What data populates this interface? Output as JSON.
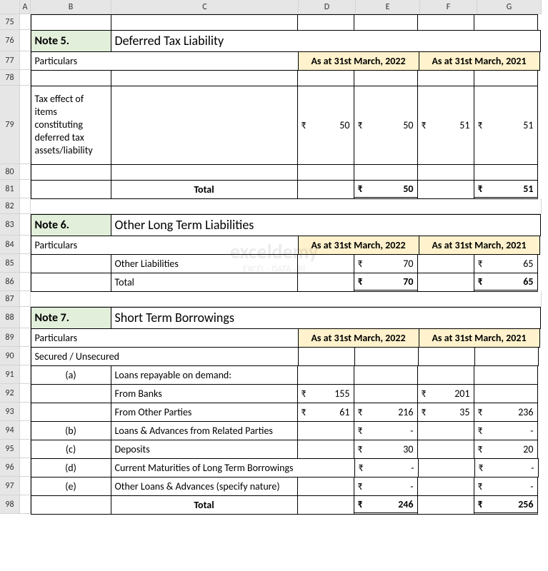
{
  "columns": [
    "A",
    "B",
    "C",
    "D",
    "E",
    "F",
    "G"
  ],
  "column_widths": {
    "A": 15,
    "B": 113,
    "C": 262,
    "D": 80,
    "E": 90,
    "F": 80,
    "G": 90
  },
  "rows": [
    75,
    76,
    77,
    78,
    79,
    80,
    81,
    82,
    83,
    84,
    85,
    86,
    87,
    88,
    89,
    90,
    91,
    92,
    93,
    94,
    95,
    96,
    97,
    98
  ],
  "row_heights": {
    "75": 22,
    "76": 30,
    "77": 26,
    "78": 22,
    "79": 110,
    "80": 22,
    "81": 26,
    "82": 22,
    "83": 30,
    "84": 26,
    "85": 26,
    "86": 26,
    "87": 22,
    "88": 30,
    "89": 26,
    "90": 26,
    "91": 26,
    "92": 26,
    "93": 26,
    "94": 26,
    "95": 26,
    "96": 26,
    "97": 26,
    "98": 26
  },
  "labels": {
    "particulars": "Particulars",
    "total": "Total",
    "date2022": "As at 31st March, 2022",
    "date2021": "As at 31st March, 2021",
    "rupee": "₹",
    "dash": "-"
  },
  "note5": {
    "header": "Note 5.",
    "title": "Deferred Tax Liability",
    "row1_label": "Tax effect of items constituting deferred tax assets/liability",
    "d": "50",
    "e": "50",
    "f": "51",
    "g": "51",
    "total_e": "50",
    "total_g": "51"
  },
  "note6": {
    "header": "Note 6.",
    "title": "Other Long Term Liabilities",
    "row1_label": "Other Liabilities",
    "e": "70",
    "g": "65",
    "total_label": "Total",
    "total_e": "70",
    "total_g": "65"
  },
  "note7": {
    "header": "Note 7.",
    "title": "Short Term Borrowings",
    "secured": "Secured / Unsecured",
    "a": "(a)",
    "b": "(b)",
    "c": "(c)",
    "d": "(d)",
    "e": "(e)",
    "a_label": "Loans repayable on demand:",
    "banks": "From Banks",
    "banks_d": "155",
    "banks_f": "201",
    "other_parties": "From Other Parties",
    "other_d": "61",
    "other_e": "216",
    "other_f": "35",
    "other_g": "236",
    "related": "Loans & Advances from Related Parties",
    "deposits": "Deposits",
    "deposits_e": "30",
    "deposits_g": "20",
    "maturities": "Current Maturities of Long Term Borrowings",
    "other_loans": "Other Loans & Advances (specify nature)",
    "total_e": "246",
    "total_g": "256"
  },
  "watermark": {
    "brand": "exceldemy",
    "tagline": "EXCEL · DATA · BI"
  }
}
